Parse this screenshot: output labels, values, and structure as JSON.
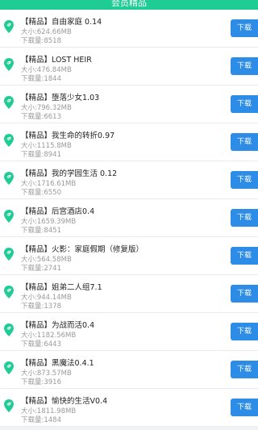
{
  "header": {
    "title": "会员精品"
  },
  "colors": {
    "header_bg": "#1fcc93",
    "button_bg": "#2c8ce6",
    "icon_green": "#1fcc93"
  },
  "icon": "leaf-pin-icon",
  "items": [
    {
      "title": "【精品】自由家庭 0.14",
      "size": "大小:624.66MB",
      "downloads": "下载量:8518",
      "button": "下载"
    },
    {
      "title": "【精品】LOST HEIR",
      "size": "大小:476.84MB",
      "downloads": "下载量:1844",
      "button": "下载"
    },
    {
      "title": "【精品】堕落少女1.03",
      "size": "大小:796.32MB",
      "downloads": "下载量:6613",
      "button": "下载"
    },
    {
      "title": "【精品】我生命的转折0.97",
      "size": "大小:1115.8MB",
      "downloads": "下载量:8941",
      "button": "下载"
    },
    {
      "title": "【精品】我的学园生活 0.12",
      "size": "大小:1716.61MB",
      "downloads": "下载量:6550",
      "button": "下载"
    },
    {
      "title": "【精品】后宫酒店0.4",
      "size": "大小:1659.39MB",
      "downloads": "下载量:8451",
      "button": "下载"
    },
    {
      "title": "【精品】火影：家庭假期（修复版）",
      "size": "大小:564.58MB",
      "downloads": "下载量:2741",
      "button": "下载"
    },
    {
      "title": "【精品】姐弟二人组7.1",
      "size": "大小:944.14MB",
      "downloads": "下载量:1378",
      "button": "下载"
    },
    {
      "title": "【精品】为战而活0.4",
      "size": "大小:1182.56MB",
      "downloads": "下载量:6443",
      "button": "下载"
    },
    {
      "title": "【精品】黑魔法0.4.1",
      "size": "大小:873.57MB",
      "downloads": "下载量:3916",
      "button": "下载"
    },
    {
      "title": "【精品】愉快的生活V0.4",
      "size": "大小:1811.98MB",
      "downloads": "下载量:1484",
      "button": "下载"
    }
  ]
}
